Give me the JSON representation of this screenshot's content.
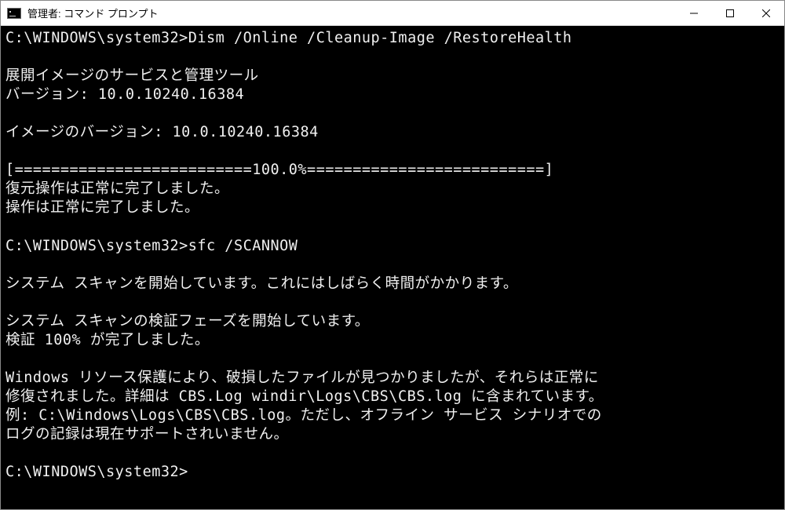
{
  "window": {
    "title": "管理者: コマンド プロンプト"
  },
  "terminal": {
    "prompt_path": "C:\\WINDOWS\\system32>",
    "lines": [
      "C:\\WINDOWS\\system32>Dism /Online /Cleanup-Image /RestoreHealth",
      "",
      "展開イメージのサービスと管理ツール",
      "バージョン: 10.0.10240.16384",
      "",
      "イメージのバージョン: 10.0.10240.16384",
      "",
      "[==========================100.0%==========================]",
      "復元操作は正常に完了しました。",
      "操作は正常に完了しました。",
      "",
      "C:\\WINDOWS\\system32>sfc /SCANNOW",
      "",
      "システム スキャンを開始しています。これにはしばらく時間がかかります。",
      "",
      "システム スキャンの検証フェーズを開始しています。",
      "検証 100% が完了しました。",
      "",
      "Windows リソース保護により、破損したファイルが見つかりましたが、それらは正常に",
      "修復されました。詳細は CBS.Log windir\\Logs\\CBS\\CBS.log に含まれています。",
      "例: C:\\Windows\\Logs\\CBS\\CBS.log。ただし、オフライン サービス シナリオでの",
      "ログの記録は現在サポートされいません。",
      "",
      "C:\\WINDOWS\\system32>"
    ]
  }
}
